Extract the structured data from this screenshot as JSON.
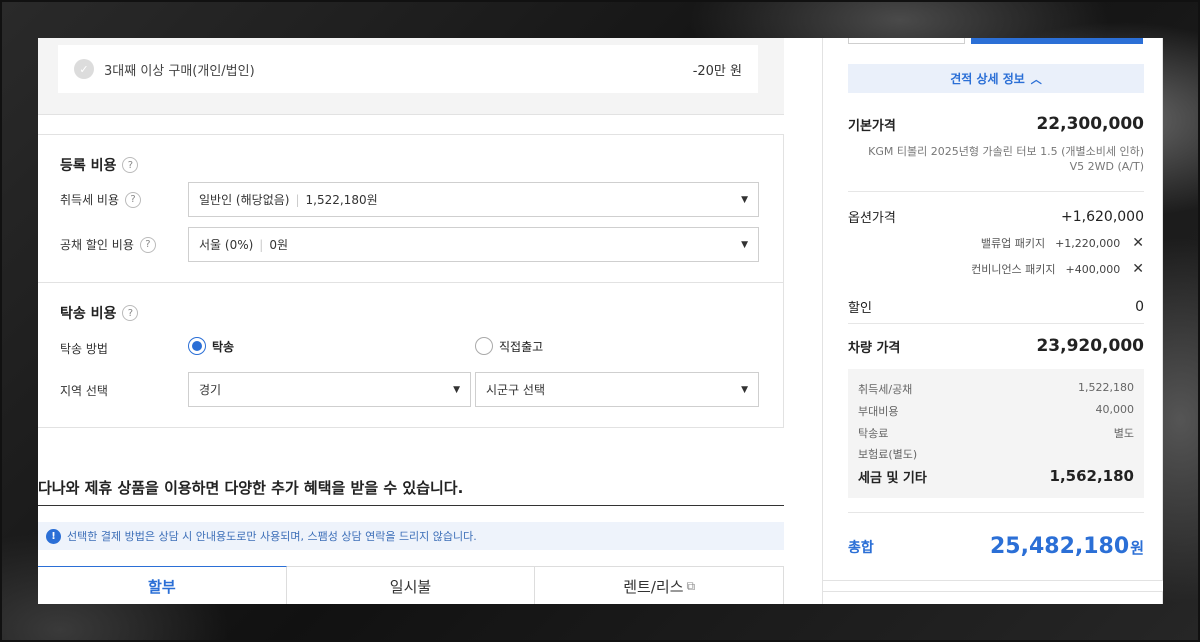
{
  "discount": {
    "label": "3대째 이상 구매(개인/법인)",
    "value": "-20만 원",
    "check_icon": "check-icon"
  },
  "registration": {
    "title": "등록 비용",
    "acq_tax_label": "취득세 비용",
    "acq_tax_option": "일반인 (해당없음)",
    "acq_tax_value": "1,522,180원",
    "bond_label": "공채 할인 비용",
    "bond_option": "서울 (0%)",
    "bond_value": "0원"
  },
  "delivery": {
    "title": "탁송 비용",
    "method_label": "탁송 방법",
    "option_delivery": "탁송",
    "option_pickup": "직접출고",
    "region_label": "지역 선택",
    "region_value": "경기",
    "district_placeholder": "시군구 선택"
  },
  "promo": {
    "title": "다나와 제휴 상품을 이용하면 다양한 추가 혜택을 받을 수 있습니다.",
    "notice": "선택한 결제 방법은 상담 시 안내용도로만 사용되며, 스팸성 상담 연락을 드리지 않습니다."
  },
  "tabs": [
    "할부",
    "일시불",
    "렌트/리스"
  ],
  "estimate": {
    "detail_button": "견적 상세 정보",
    "base_label": "기본가격",
    "base_value": "22,300,000",
    "model_line1": "KGM 티볼리 2025년형 가솔린 터보 1.5 (개별소비세 인하)",
    "model_line2": "V5 2WD (A/T)",
    "option_label": "옵션가격",
    "option_value": "+1,620,000",
    "options": [
      {
        "name": "밸류업 패키지",
        "price": "+1,220,000"
      },
      {
        "name": "컨비니언스 패키지",
        "price": "+400,000"
      }
    ],
    "discount_label": "할인",
    "discount_value": "0",
    "car_price_label": "차량 가격",
    "car_price_value": "23,920,000",
    "tax_rows": [
      {
        "label": "취득세/공채",
        "value": "1,522,180"
      },
      {
        "label": "부대비용",
        "value": "40,000"
      },
      {
        "label": "탁송료",
        "value": "별도"
      },
      {
        "label": "보험료(별도)",
        "value": ""
      }
    ],
    "tax_total_label": "세금 및 기타",
    "tax_total_value": "1,562,180",
    "total_label": "총합",
    "total_value": "25,482,180",
    "total_unit": "원"
  },
  "colors": {
    "accent": "#2b6fd6",
    "notice_bg": "#eef3fb"
  }
}
